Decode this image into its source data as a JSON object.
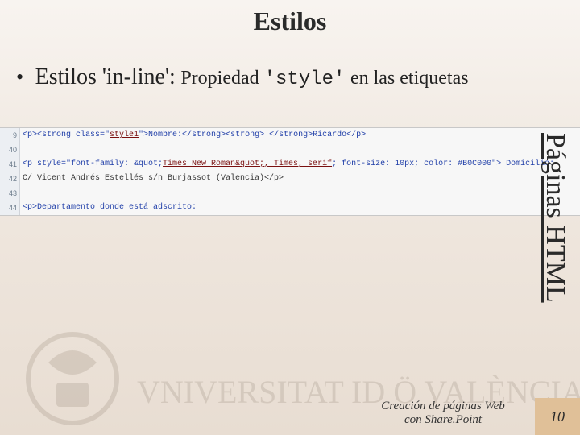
{
  "title": "Estilos",
  "bullet": {
    "dot": "•",
    "topic": "Estilos 'in-line':",
    "prop": " Propiedad ",
    "code": "'style'",
    "tail": " en las etiquetas"
  },
  "code": {
    "line_numbers": [
      "9",
      "40",
      "41",
      "42",
      "43",
      "44"
    ],
    "l0_a": "<p><strong class=\"",
    "l0_b": "style1",
    "l0_c": "\">Nombre:</strong><strong> </strong>Ricardo</p>",
    "l1_blank": "",
    "l2_a": "<p style=\"font-family: &quot;",
    "l2_b": "Times New Roman&quot;, Times, serif",
    "l2_c": "; font-size: 10px; color: #B0C000\"> Domicilio:",
    "l3": "                                      C/ Vicent Andrés Estellés s/n Burjassot (Valencia)</p>",
    "l4_blank": "",
    "l5": "<p>Departamento donde está adscrito:"
  },
  "sidebar": "Páginas HTML",
  "watermark_text": "VNIVERSITAT ID Ö VALÈNCIA",
  "footer": {
    "caption_line1": "Creación de páginas Web",
    "caption_line2": "con Share.Point",
    "page": "10"
  }
}
